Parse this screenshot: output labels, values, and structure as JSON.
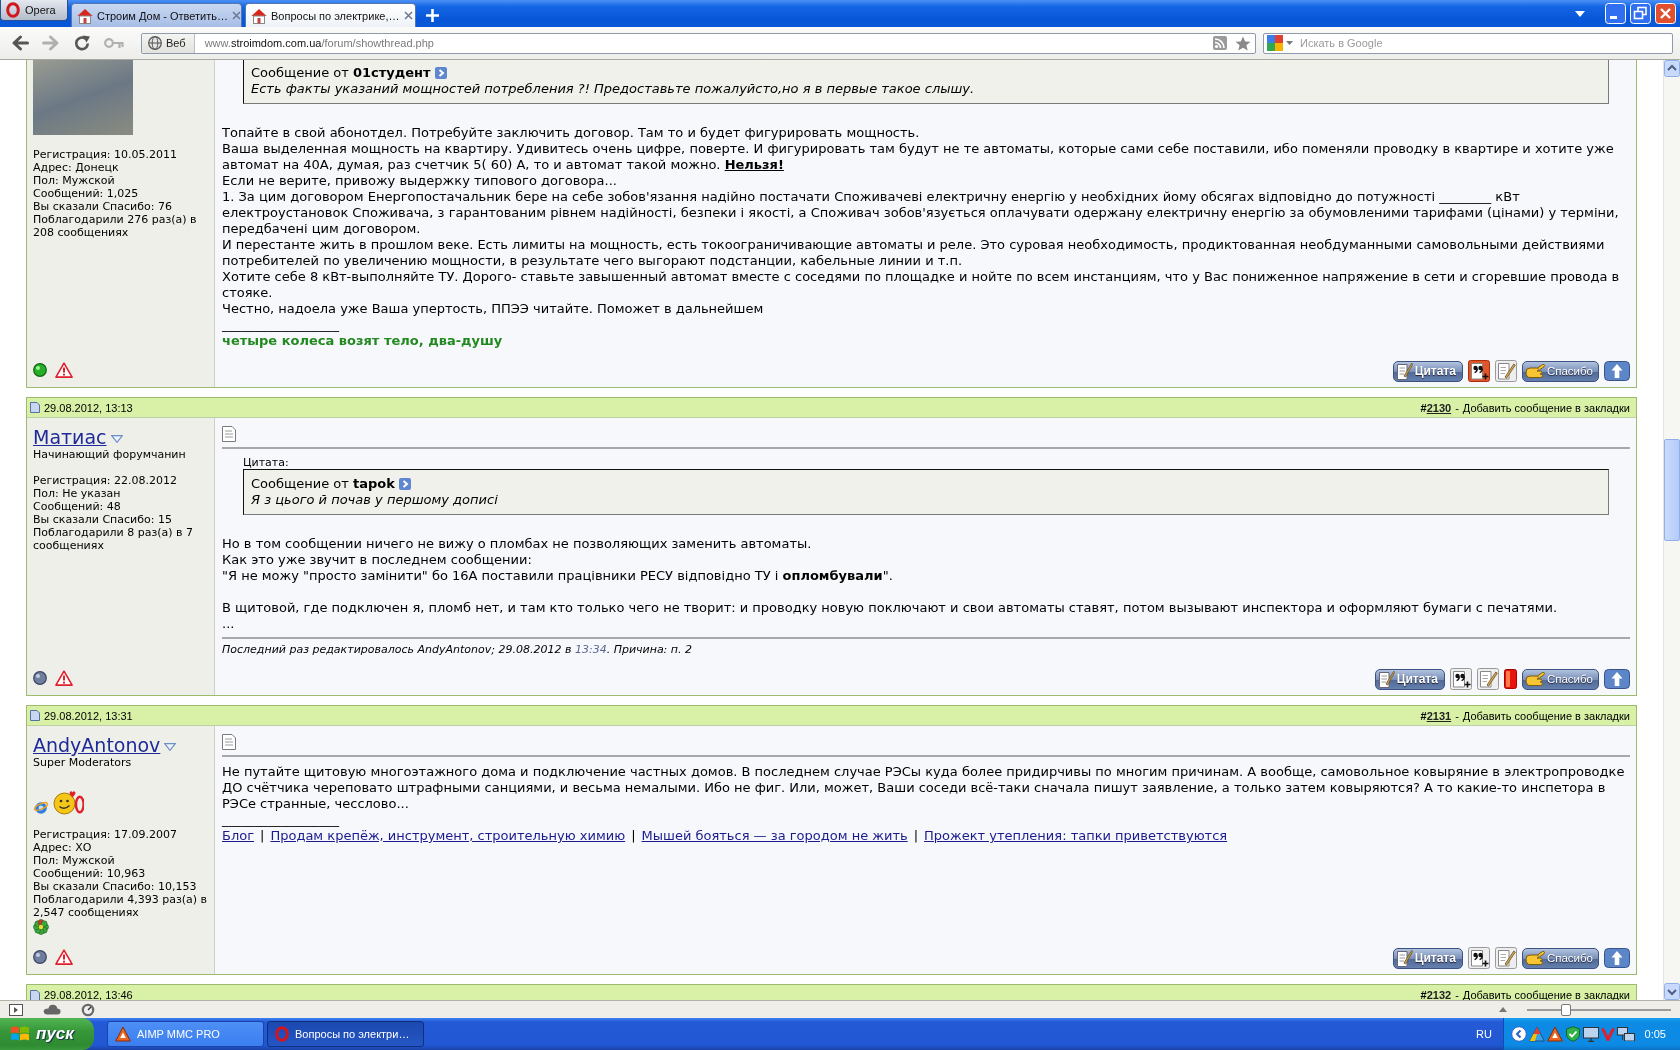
{
  "browser": {
    "opera_button": {
      "label": "Opera"
    },
    "tabs": [
      {
        "title": "Строим Дом - Ответить…",
        "selected": false
      },
      {
        "title": "Вопросы по электрике,…",
        "selected": true
      }
    ],
    "nav": [
      {
        "kind": "back",
        "disabled": false
      },
      {
        "kind": "forward",
        "disabled": true
      },
      {
        "kind": "reload",
        "disabled": false
      },
      {
        "kind": "wand",
        "disabled": true
      }
    ],
    "address_bar": {
      "mode": "Веб",
      "url": [
        {
          "text": "www.",
          "highlight": false
        },
        {
          "text": "stroimdom.com.ua",
          "highlight": true
        },
        {
          "text": "/forum/showthread.php",
          "highlight": false
        }
      ]
    },
    "search": {
      "placeholder": "Искать в Google"
    }
  },
  "posts": [
    {
      "user": {
        "avatar": {
          "kind": "photo"
        },
        "stats": [
          "Регистрация: 10.05.2011",
          "Адрес: Донецк",
          "Пол: Мужской",
          "Сообщений: 1,025",
          "Вы сказали Спасибо: 76",
          "Поблагодарили 276 раз(а) в 208 сообщениях"
        ],
        "online": true
      },
      "body": {
        "quote": {
          "attribution": "Сообщение от **01студент**",
          "text": "Есть факты указаний мощностей потребления ?! Предоставьте пожалуйсто,но я в первые такое слышу."
        },
        "paragraphs": [
          {
            "kind": "text",
            "text": "Топайте в свой абонотдел. Потребуйте заключить договор. Там то и будет фигурировать мощность."
          },
          {
            "kind": "text",
            "text": "Ваша выделенная мощность на квартиру. Удивитесь очень цифре, поверте. И фигурировать там будут не те автоматы, которые сами себе поставили, ибо поменяли проводку в квартире и хотите уже автомат на 40А, думая, раз счетчик 5( 60) А, то и автомат такой можно. **Нельзя!**",
            "underline_bold": true
          },
          {
            "kind": "text",
            "text": "Если не верите, привожу выдержку типового договора..."
          },
          {
            "kind": "text",
            "text": "1. За цим договором Енергопостачальник бере на себе зобов'язання надійно постачати Споживачеві електричну енергію у необхідних йому обсягах відповідно до потужності ________ кВт електроустановок Споживача, з гарантованим рівнем надійності, безпеки і якості, а Споживач зобов'язується оплачувати одержану електричну енергію за обумовленими тарифами (цінами) у терміни, передбачені цим договором."
          },
          {
            "kind": "text",
            "text": "И перестанте жить в прошлом веке. Есть лимиты на мощность, есть токоограничивающие автоматы и реле. Это суровая необходимость, продиктованная необдуманными самовольными действиями потребителей по увеличению мощности, в результате чего выгорают подстанции, кабельные линии и т.п."
          },
          {
            "kind": "text",
            "text": "Хотите себе 8 кВт-выполняйте ТУ. Дорого- ставьте завышенный автомат вместе с соседями по площадке и нойте по всем инстанциям, что у Вас пониженное напряжение в сети и сгоревшие провода в стояке."
          },
          {
            "kind": "text",
            "text": "Честно, надоела уже Ваша упертость, ППЭЭ читайте. Поможет в дальнейшем"
          }
        ],
        "signature": {
          "kind": "text",
          "rule": "__________________",
          "text": "четыре колеса возят тело, два-душу"
        }
      },
      "buttons": [
        {
          "kind": "quote",
          "label": "Цитата"
        },
        {
          "kind": "multiquote",
          "on": true
        },
        {
          "kind": "edit"
        },
        {
          "kind": "thanks",
          "label": "Спасибо"
        },
        {
          "kind": "top"
        }
      ]
    },
    {
      "header": {
        "date": "29.08.2012, 13:13",
        "number_prefix": "#",
        "number": "2130",
        "separator": "-",
        "bookmark": "Добавить сообщение в закладки"
      },
      "user": {
        "name": "Матиас",
        "title": "Начинающий форумчанин",
        "stats": [
          "Регистрация: 22.08.2012",
          "Пол: Не указан",
          "Сообщений: 48",
          "Вы сказали Спасибо: 15",
          "Поблагодарили 8 раз(а) в 7 сообщениях"
        ],
        "online": false
      },
      "body": {
        "title_icon": {
          "kind": "document"
        },
        "quote_label": "Цитата:",
        "quote": {
          "attribution": "Сообщение от **tapok**",
          "text": "Я з цього й почав у першому дописі"
        },
        "paragraphs": [
          {
            "kind": "text",
            "text": "Но в том сообщении ничего не вижу о пломбах не позволяющих заменить автоматы."
          },
          {
            "kind": "text",
            "text": "Как это уже звучит в последнем сообщении:"
          },
          {
            "kind": "text",
            "text": "\"Я не можу \"просто замінити\" бо 16А поставили працівники РЕСУ відповідно ТУ і **опломбували**\"."
          },
          {
            "kind": "break"
          },
          {
            "kind": "text",
            "text": "В щитовой, где подключен я, пломб нет, и там кто только чего не творит: и проводку новую поключают и свои автоматы ставят, потом вызывают инспектора и оформляют бумаги с печатями."
          },
          {
            "kind": "text",
            "text": "..."
          }
        ],
        "edit_note": {
          "text": "Последний раз редактировалось AndyAntonov; 29.08.2012 в ",
          "time": "13:34",
          "reason": ". Причина: п. 2"
        }
      },
      "buttons": [
        {
          "kind": "quote",
          "label": "Цитата"
        },
        {
          "kind": "multiquote",
          "on": false
        },
        {
          "kind": "edit"
        },
        {
          "kind": "infraction"
        },
        {
          "kind": "thanks",
          "label": "Спасибо"
        },
        {
          "kind": "top"
        }
      ]
    },
    {
      "header": {
        "date": "29.08.2012, 13:31",
        "number_prefix": "#",
        "number": "2131",
        "separator": "-",
        "bookmark": "Добавить сообщение в закладки"
      },
      "user": {
        "name": "AndyAntonov",
        "title": "Super Moderators",
        "badges": [
          {
            "kind": "globe"
          },
          {
            "kind": "smiley"
          }
        ],
        "stats": [
          "Регистрация: 17.09.2007",
          "Адрес: ХО",
          "Пол: Мужской",
          "Сообщений: 10,963",
          "Вы сказали Спасибо: 10,153",
          "Поблагодарили 4,393 раз(а) в 2,547 сообщениях"
        ],
        "contacts": [
          {
            "kind": "icq"
          }
        ],
        "online": false
      },
      "body": {
        "title_icon": {
          "kind": "document"
        },
        "paragraphs": [
          {
            "kind": "text",
            "text": "Не путайте щитовую многоэтажного дома и подключение частных домов. В последнем случае РЭСы куда более придирчивы по многим причинам. А вообще, самовольное ковыряние в электропроводке ДО счётчика череповато штрафными санциями, и весьма немалыми. Ибо не фиг. Или, может, Ваши соседи всё-таки сначала пишут заявление, а только затем ковыряются? А то какие-то инспетора в РЭСе странные, чесслово..."
          }
        ],
        "signature": {
          "kind": "links",
          "rule": "__________________",
          "links": [
            "Блог",
            "Продам крепёж, инструмент, строительную химию",
            "Мышей бояться — за городом не жить",
            "Прожект утепления: тапки приветствуются"
          ],
          "divider": "|"
        }
      },
      "buttons": [
        {
          "kind": "quote",
          "label": "Цитата"
        },
        {
          "kind": "multiquote",
          "on": false
        },
        {
          "kind": "edit"
        },
        {
          "kind": "thanks",
          "label": "Спасибо"
        },
        {
          "kind": "top"
        }
      ]
    },
    {
      "header": {
        "date": "29.08.2012, 13:46",
        "number_prefix": "#",
        "number": "2132",
        "separator": "-",
        "bookmark": "Добавить сообщение в закладки"
      }
    }
  ],
  "status_bar": {
    "zoom_slider": {
      "level": 0.27
    }
  },
  "taskbar": {
    "start": "пуск",
    "tasks": [
      {
        "kind": "player",
        "label": "AIMP MMC PRO",
        "selected": false
      },
      {
        "kind": "browser",
        "label": "Вопросы по электри…",
        "selected": true
      }
    ],
    "language": "RU",
    "clock": "0:05"
  }
}
